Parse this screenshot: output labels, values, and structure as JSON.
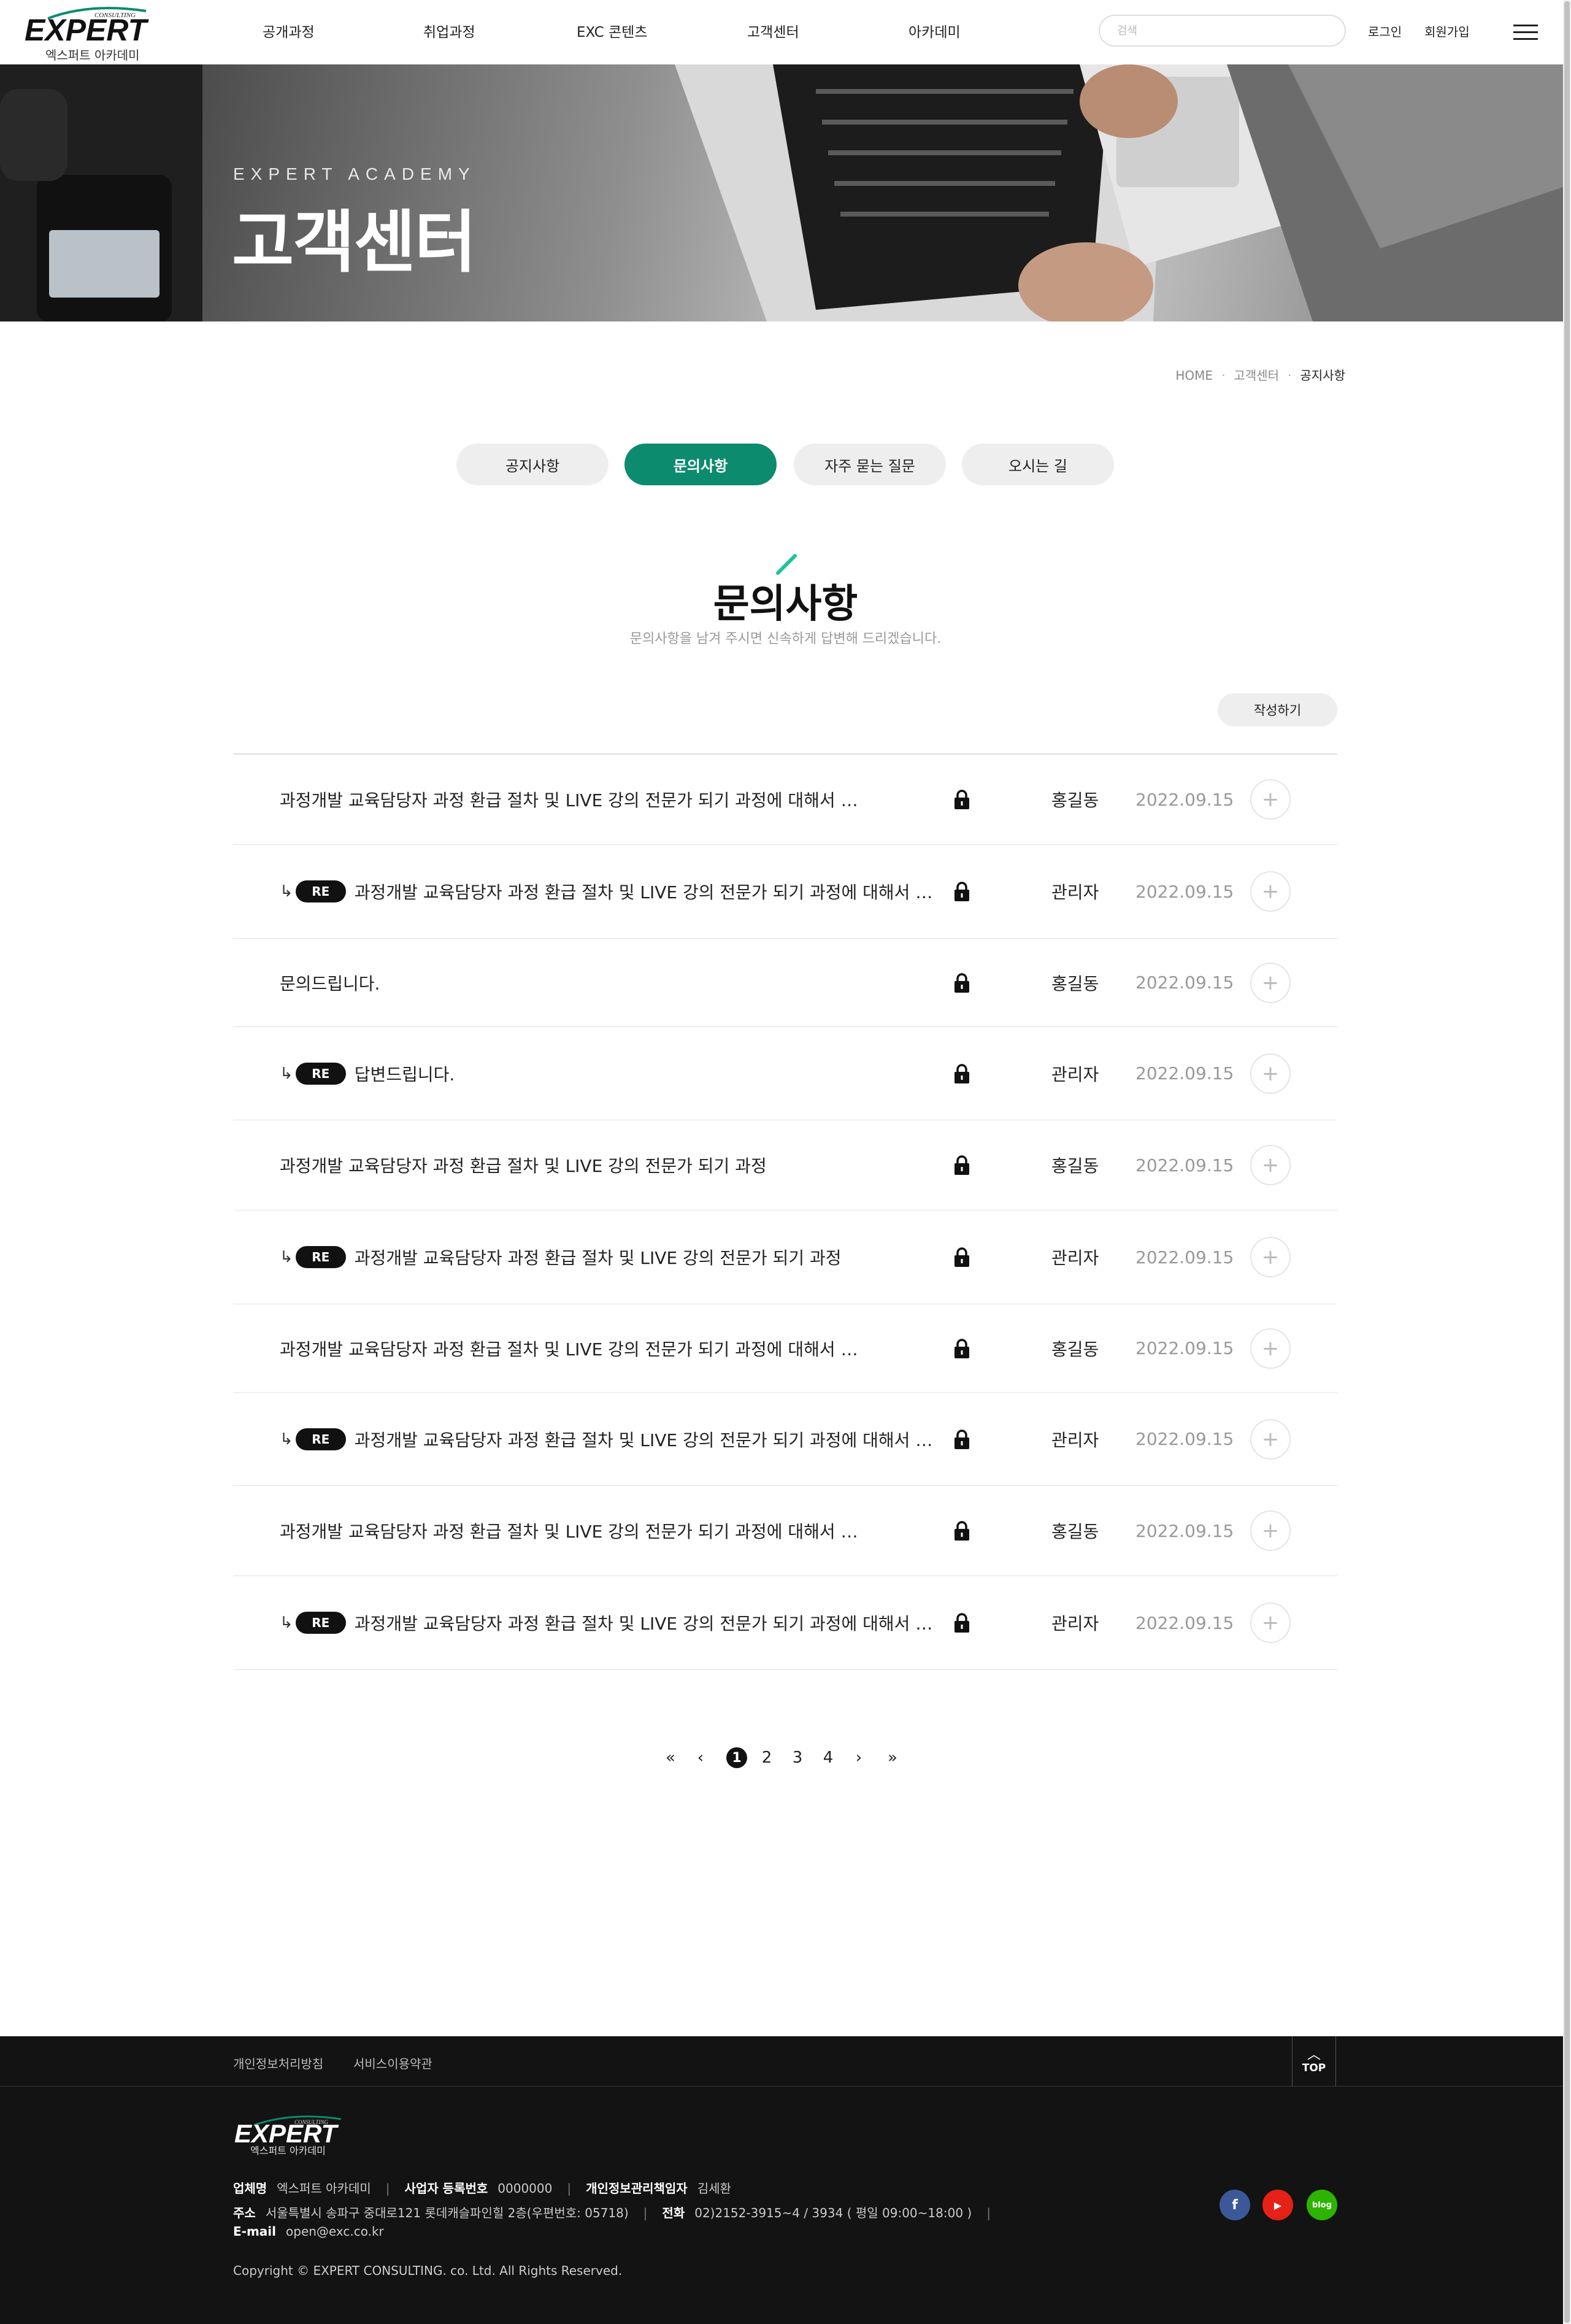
{
  "brand": {
    "logo_text": "EXPERT",
    "logo_tag": "CONSULTING",
    "subtitle": "엑스퍼트 아카데미"
  },
  "nav": [
    "공개과정",
    "취업과정",
    "EXC 콘텐츠",
    "고객센터",
    "아카데미"
  ],
  "search": {
    "placeholder": "검색"
  },
  "util": {
    "login": "로그인",
    "signup": "회원가입"
  },
  "hero": {
    "subtitle": "EXPERT ACADEMY",
    "title": "고객센터"
  },
  "breadcrumb": [
    "HOME",
    "고객센터",
    "공지사항"
  ],
  "tabs": [
    {
      "label": "공지사항",
      "active": false
    },
    {
      "label": "문의사항",
      "active": true
    },
    {
      "label": "자주 묻는 질문",
      "active": false
    },
    {
      "label": "오시는 길",
      "active": false
    }
  ],
  "section": {
    "title": "문의사항",
    "description": "문의사항을 남겨 주시면 신속하게 답변해 드리겠습니다."
  },
  "write_button": "작성하기",
  "posts": [
    {
      "reply": false,
      "title": "과정개발 교육담당자 과정 환급 절차 및 LIVE 강의 전문가 되기 과정에 대해서 문의드립니다.",
      "author": "홍길동",
      "date": "2022.09.15"
    },
    {
      "reply": true,
      "title": "과정개발 교육담당자 과정 환급 절차 및 LIVE 강의 전문가 되기 과정에 대해서 문의드립니다.",
      "author": "관리자",
      "date": "2022.09.15"
    },
    {
      "reply": false,
      "title": "문의드립니다.",
      "author": "홍길동",
      "date": "2022.09.15"
    },
    {
      "reply": true,
      "title": "답변드립니다.",
      "author": "관리자",
      "date": "2022.09.15"
    },
    {
      "reply": false,
      "title": "과정개발 교육담당자 과정 환급 절차 및 LIVE 강의 전문가 되기 과정",
      "author": "홍길동",
      "date": "2022.09.15"
    },
    {
      "reply": true,
      "title": "과정개발 교육담당자 과정 환급 절차 및 LIVE 강의 전문가 되기 과정",
      "author": "관리자",
      "date": "2022.09.15"
    },
    {
      "reply": false,
      "title": "과정개발 교육담당자 과정 환급 절차 및 LIVE 강의 전문가 되기 과정에 대해서 문의드립니다.",
      "author": "홍길동",
      "date": "2022.09.15"
    },
    {
      "reply": true,
      "title": "과정개발 교육담당자 과정 환급 절차 및 LIVE 강의 전문가 되기 과정에 대해서 문의드립니다.",
      "author": "관리자",
      "date": "2022.09.15"
    },
    {
      "reply": false,
      "title": "과정개발 교육담당자 과정 환급 절차 및 LIVE 강의 전문가 되기 과정에 대해서 문의드립니다.",
      "author": "홍길동",
      "date": "2022.09.15"
    },
    {
      "reply": true,
      "title": "과정개발 교육담당자 과정 환급 절차 및 LIVE 강의 전문가 되기 과정에 대해서 문의드립니다.",
      "author": "관리자",
      "date": "2022.09.15"
    }
  ],
  "re_label": "RE",
  "pagination": {
    "pages": [
      "1",
      "2",
      "3",
      "4"
    ],
    "current": "1"
  },
  "footer": {
    "links": [
      "개인정보처리방침",
      "서비스이용약관"
    ],
    "top_label": "TOP",
    "company_label": "업체명",
    "company": "엑스퍼트 아카데미",
    "bizno_label": "사업자 등록번호",
    "bizno": "0000000",
    "privacy_label": "개인정보관리책임자",
    "privacy_officer": "김세환",
    "address_label": "주소",
    "address": "서울특별시 송파구 중대로121 롯데캐슬파인힐 2층(우편번호: 05718)",
    "phone_label": "전화",
    "phone": "02)2152-3915~4 / 3934 ( 평일 09:00~18:00 )",
    "email_label": "E-mail",
    "email": "open@exc.co.kr",
    "copyright": "Copyright © EXPERT CONSULTING. co. Ltd. All Rights Reserved.",
    "sns": [
      {
        "icon": "facebook-icon",
        "glyph": "f",
        "color": "#3b5998"
      },
      {
        "icon": "youtube-icon",
        "glyph": "▶",
        "color": "#e62117"
      },
      {
        "icon": "blog-icon",
        "glyph": "blog",
        "color": "#2db400"
      }
    ]
  },
  "colors": {
    "accent": "#0d8b6e",
    "footer_bg": "#131313"
  }
}
